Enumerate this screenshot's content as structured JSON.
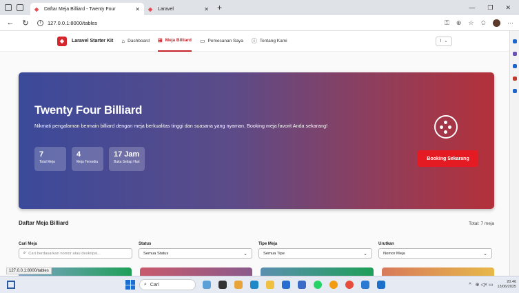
{
  "browser": {
    "tabs": [
      {
        "title": "Daftar Meja Billiard - Twenty Four",
        "active": true
      },
      {
        "title": "Laravel",
        "active": false
      }
    ],
    "new_tab": "+",
    "url": "127.0.0.1:8000/tables",
    "status_url": "127.0.0.1:8000/tables"
  },
  "app": {
    "brand": "Laravel Starter Kit",
    "nav": [
      {
        "label": "Dashboard",
        "icon": "home-icon"
      },
      {
        "label": "Meja Billiard",
        "icon": "grid-icon",
        "active": true
      },
      {
        "label": "Pemesanan Saya",
        "icon": "calendar-icon"
      },
      {
        "label": "Tentang Kami",
        "icon": "info-icon"
      }
    ],
    "user_initial": "I"
  },
  "hero": {
    "title": "Twenty Four Billiard",
    "description": "Nikmati pengalaman bermain billiard dengan meja berkualitas tinggi dan suasana yang nyaman. Booking meja favorit Anda sekarang!",
    "stats": [
      {
        "value": "7",
        "label": "Total Meja"
      },
      {
        "value": "4",
        "label": "Meja Tersedia"
      },
      {
        "value": "17 Jam",
        "label": "Buka Setiap Hari"
      }
    ],
    "cta": "Booking Sekarang"
  },
  "list": {
    "title": "Daftar Meja Billiard",
    "total": "Total: 7 meja",
    "filters": {
      "search_label": "Cari Meja",
      "search_placeholder": "Cari berdasarkan nomor atau deskripsi...",
      "status_label": "Status",
      "status_value": "Semua Status",
      "type_label": "Tipe Meja",
      "type_value": "Semua Tipe",
      "sort_label": "Urutkan",
      "sort_value": "Nomor Meja"
    }
  },
  "taskbar": {
    "search": "Cari",
    "time": "20.46",
    "date": "13/06/2025"
  },
  "colors": {
    "accent": "#c4232a",
    "button": "#e41b23",
    "hero_start": "#3b4a9a",
    "hero_end": "#b3313a"
  }
}
